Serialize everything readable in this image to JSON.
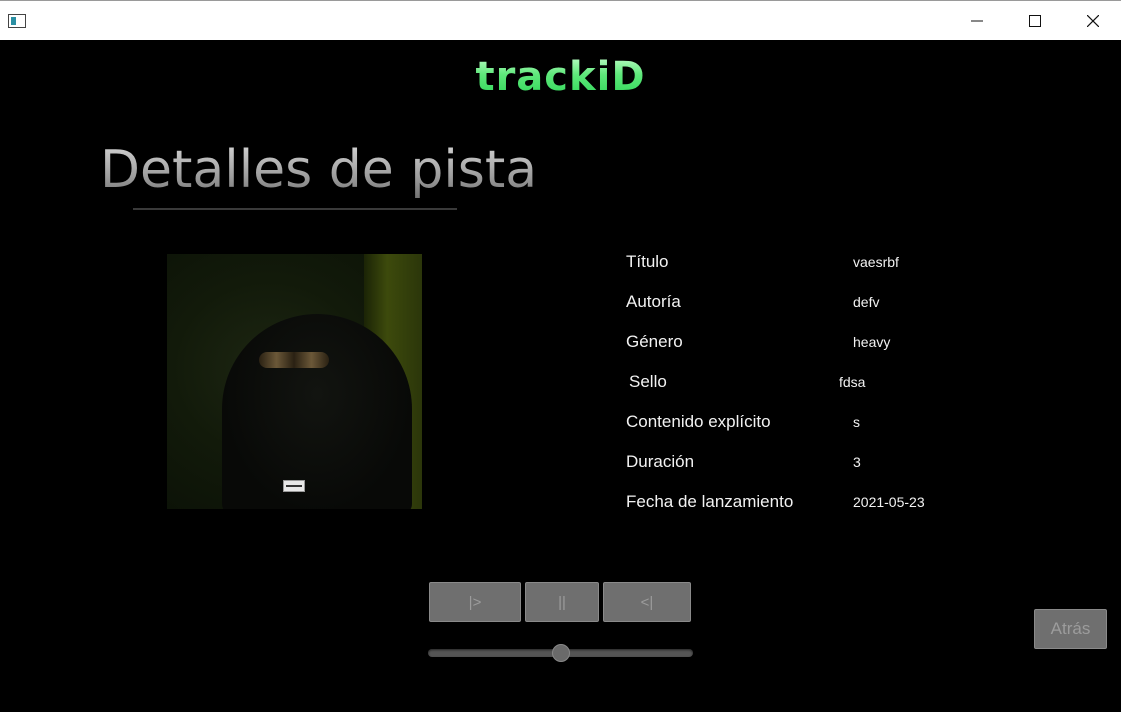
{
  "window": {
    "app_icon": "window-icon",
    "controls": [
      "minimize-icon",
      "maximize-icon",
      "close-icon"
    ]
  },
  "brand": {
    "logo_text": "trackiD",
    "color": "#4ee36e"
  },
  "page": {
    "title": "Detalles de pista"
  },
  "cover": {
    "icon": "album-cover-image"
  },
  "details": [
    {
      "label": "Título",
      "value": "vaesrbf"
    },
    {
      "label": "Autoría",
      "value": "defv"
    },
    {
      "label": "Género",
      "value": "heavy"
    },
    {
      "label": " Sello",
      "value": "fdsa"
    },
    {
      "label": "Contenido explícito",
      "value": "s"
    },
    {
      "label": "Duración",
      "value": "3"
    },
    {
      "label": "Fecha de lanzamiento",
      "value": "2021-05-23"
    }
  ],
  "player": {
    "play_label": "|>",
    "pause_label": "||",
    "back_label": "<|",
    "progress_fraction": 0.5
  },
  "nav": {
    "back_label": "Atrás"
  }
}
